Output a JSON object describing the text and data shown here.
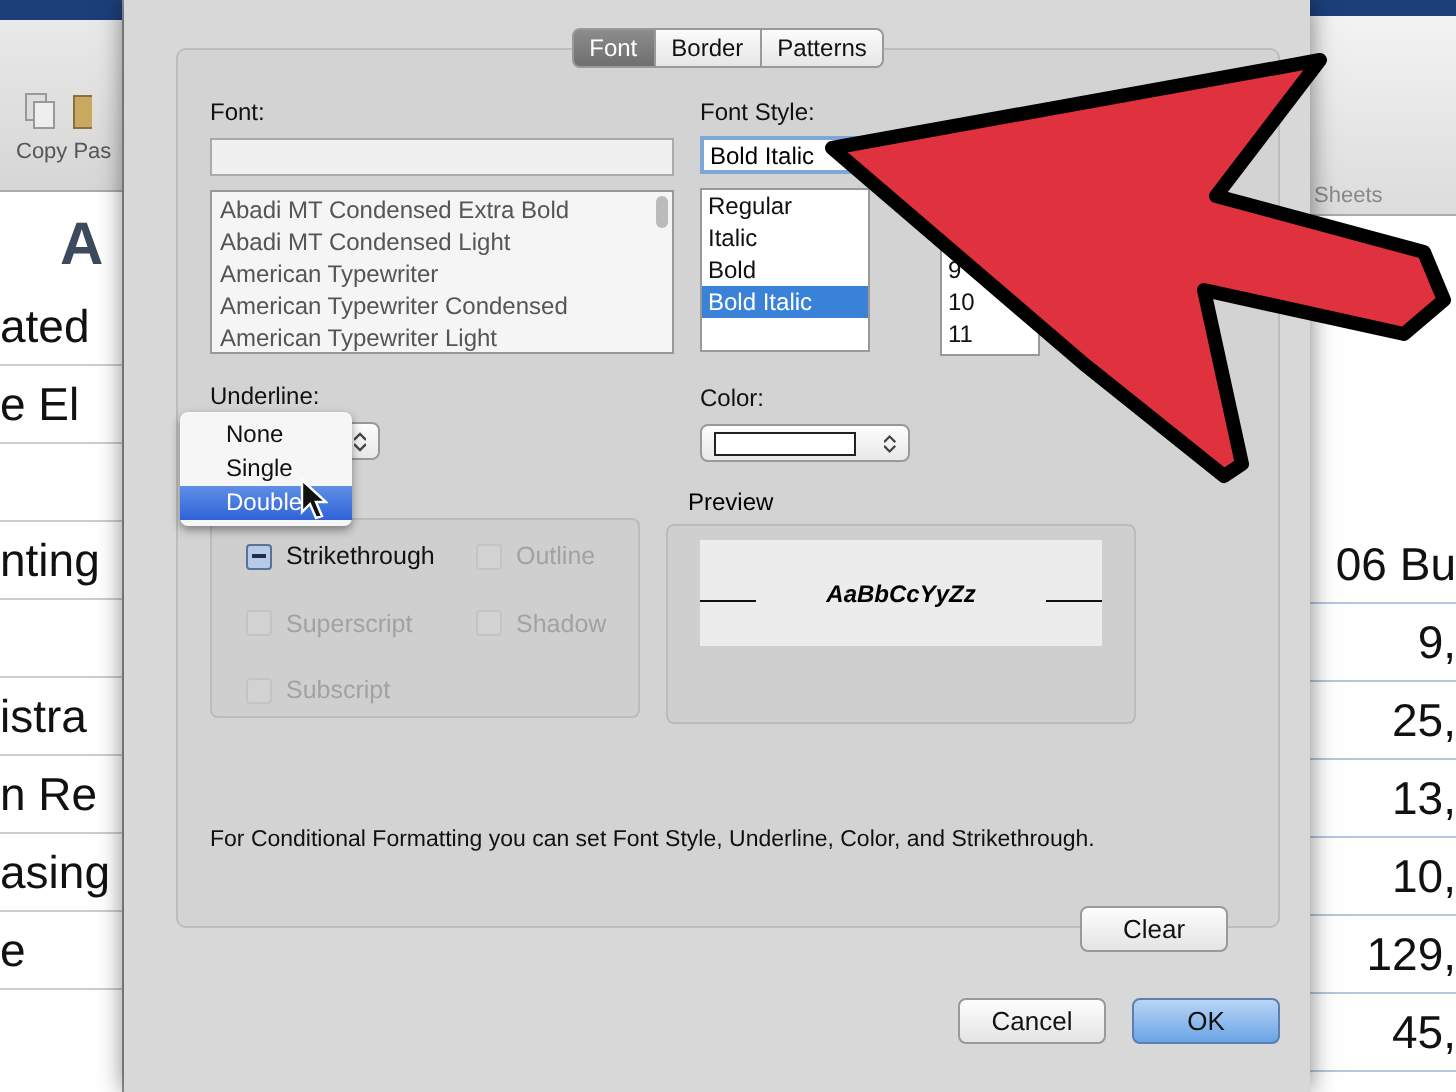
{
  "background_sheet": {
    "toolbar_items": [
      "Copy",
      "Pas"
    ],
    "column_heading": "A",
    "left_cells": [
      "ated",
      "e El",
      "",
      "nting",
      "",
      "istra",
      "n Re",
      "asing",
      "e"
    ],
    "sheets_tab": "Sheets",
    "right_cells": [
      "06 Bu",
      "9,",
      "25,",
      "13,",
      "10,",
      "129,",
      "45,"
    ]
  },
  "dialog": {
    "tabs": [
      {
        "label": "Font",
        "selected": true
      },
      {
        "label": "Border",
        "selected": false
      },
      {
        "label": "Patterns",
        "selected": false
      }
    ],
    "font": {
      "label": "Font:",
      "items": [
        "Abadi MT Condensed Extra Bold",
        "Abadi MT Condensed Light",
        "American Typewriter",
        "American Typewriter Condensed",
        "American Typewriter Light"
      ]
    },
    "font_style": {
      "label": "Font Style:",
      "value": "Bold Italic",
      "items": [
        {
          "label": "Regular",
          "selected": false
        },
        {
          "label": "Italic",
          "selected": false
        },
        {
          "label": "Bold",
          "selected": false
        },
        {
          "label": "Bold Italic",
          "selected": true
        }
      ]
    },
    "size_list": {
      "items": [
        "9",
        "10",
        "11"
      ]
    },
    "underline": {
      "label": "Underline:",
      "menu": [
        {
          "label": "None",
          "selected": false
        },
        {
          "label": "Single",
          "selected": false
        },
        {
          "label": "Double",
          "selected": true
        }
      ]
    },
    "color": {
      "label": "Color:"
    },
    "effects": [
      {
        "label": "Strikethrough",
        "mixed": true,
        "disabled": false
      },
      {
        "label": "Outline",
        "mixed": false,
        "disabled": true
      },
      {
        "label": "Superscript",
        "mixed": false,
        "disabled": true
      },
      {
        "label": "Shadow",
        "mixed": false,
        "disabled": true
      },
      {
        "label": "Subscript",
        "mixed": false,
        "disabled": true
      }
    ],
    "preview": {
      "label": "Preview",
      "sample": "AaBbCcYyZz"
    },
    "note": "For Conditional Formatting you can set Font Style, Underline, Color, and Strikethrough.",
    "clear_button": "Clear",
    "buttons": [
      {
        "label": "Cancel",
        "default": false
      },
      {
        "label": "OK",
        "default": true
      }
    ]
  }
}
